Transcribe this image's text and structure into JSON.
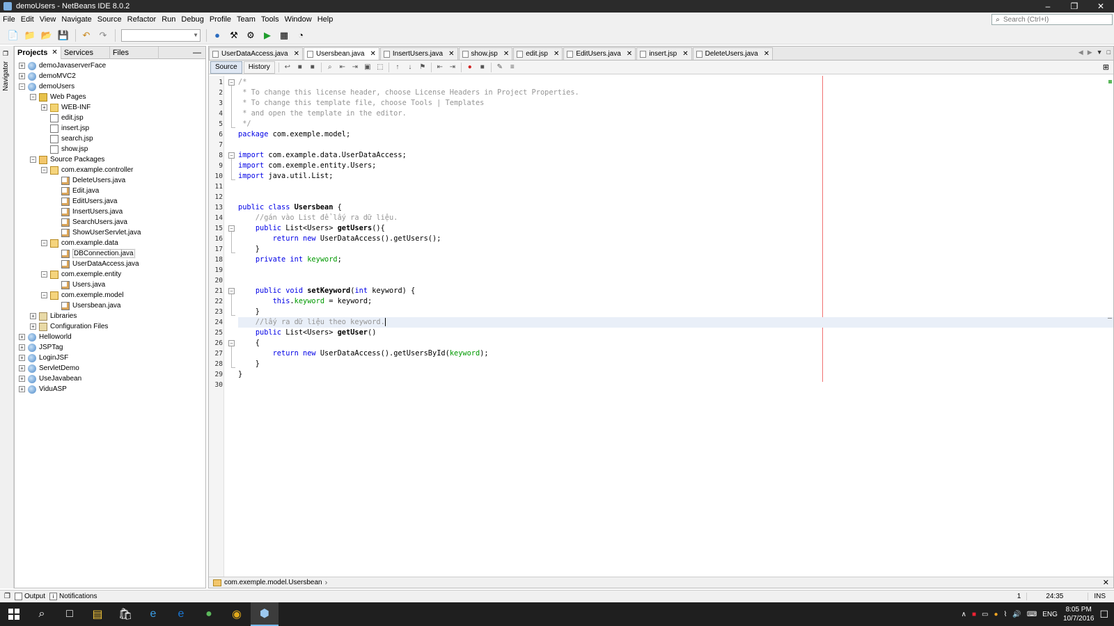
{
  "window": {
    "title": "demoUsers - NetBeans IDE 8.0.2",
    "controls": [
      "–",
      "❐",
      "✕"
    ]
  },
  "menu": {
    "items": [
      "File",
      "Edit",
      "View",
      "Navigate",
      "Source",
      "Refactor",
      "Run",
      "Debug",
      "Profile",
      "Team",
      "Tools",
      "Window",
      "Help"
    ],
    "search_placeholder": "Search (Ctrl+I)"
  },
  "side_strip": {
    "label": "Navigator"
  },
  "projects_panel": {
    "tabs": [
      "Projects",
      "Services",
      "Files"
    ],
    "active_tab": "Projects",
    "tree": [
      {
        "label": "demoJavaserverFace",
        "depth": 0,
        "toggle": "+",
        "icon": "project"
      },
      {
        "label": "demoMVC2",
        "depth": 0,
        "toggle": "+",
        "icon": "project"
      },
      {
        "label": "demoUsers",
        "depth": 0,
        "toggle": "−",
        "icon": "project"
      },
      {
        "label": "Web Pages",
        "depth": 1,
        "toggle": "−",
        "icon": "webpages"
      },
      {
        "label": "WEB-INF",
        "depth": 2,
        "toggle": "+",
        "icon": "folder"
      },
      {
        "label": "edit.jsp",
        "depth": 2,
        "toggle": "",
        "icon": "file"
      },
      {
        "label": "insert.jsp",
        "depth": 2,
        "toggle": "",
        "icon": "file"
      },
      {
        "label": "search.jsp",
        "depth": 2,
        "toggle": "",
        "icon": "file"
      },
      {
        "label": "show.jsp",
        "depth": 2,
        "toggle": "",
        "icon": "file"
      },
      {
        "label": "Source Packages",
        "depth": 1,
        "toggle": "−",
        "icon": "srcpkg"
      },
      {
        "label": "com.example.controller",
        "depth": 2,
        "toggle": "−",
        "icon": "package"
      },
      {
        "label": "DeleteUsers.java",
        "depth": 3,
        "toggle": "",
        "icon": "java"
      },
      {
        "label": "Edit.java",
        "depth": 3,
        "toggle": "",
        "icon": "java"
      },
      {
        "label": "EditUsers.java",
        "depth": 3,
        "toggle": "",
        "icon": "java"
      },
      {
        "label": "InsertUsers.java",
        "depth": 3,
        "toggle": "",
        "icon": "java"
      },
      {
        "label": "SearchUsers.java",
        "depth": 3,
        "toggle": "",
        "icon": "java"
      },
      {
        "label": "ShowUserServlet.java",
        "depth": 3,
        "toggle": "",
        "icon": "java"
      },
      {
        "label": "com.example.data",
        "depth": 2,
        "toggle": "−",
        "icon": "package"
      },
      {
        "label": "DBConnection.java",
        "depth": 3,
        "toggle": "",
        "icon": "java",
        "selected": true
      },
      {
        "label": "UserDataAccess.java",
        "depth": 3,
        "toggle": "",
        "icon": "java"
      },
      {
        "label": "com.exemple.entity",
        "depth": 2,
        "toggle": "−",
        "icon": "package"
      },
      {
        "label": "Users.java",
        "depth": 3,
        "toggle": "",
        "icon": "java"
      },
      {
        "label": "com.exemple.model",
        "depth": 2,
        "toggle": "−",
        "icon": "package"
      },
      {
        "label": "Usersbean.java",
        "depth": 3,
        "toggle": "",
        "icon": "java"
      },
      {
        "label": "Libraries",
        "depth": 1,
        "toggle": "+",
        "icon": "lib"
      },
      {
        "label": "Configuration Files",
        "depth": 1,
        "toggle": "+",
        "icon": "config"
      },
      {
        "label": "Helloworld",
        "depth": 0,
        "toggle": "+",
        "icon": "project"
      },
      {
        "label": "JSPTag",
        "depth": 0,
        "toggle": "+",
        "icon": "project"
      },
      {
        "label": "LoginJSF",
        "depth": 0,
        "toggle": "+",
        "icon": "project"
      },
      {
        "label": "ServletDemo",
        "depth": 0,
        "toggle": "+",
        "icon": "project"
      },
      {
        "label": "UseJavabean",
        "depth": 0,
        "toggle": "+",
        "icon": "project"
      },
      {
        "label": "ViduASP",
        "depth": 0,
        "toggle": "+",
        "icon": "project"
      }
    ]
  },
  "editor": {
    "tabs": [
      {
        "label": "UserDataAccess.java",
        "active": false
      },
      {
        "label": "Usersbean.java",
        "active": true
      },
      {
        "label": "InsertUsers.java",
        "active": false
      },
      {
        "label": "show.jsp",
        "active": false
      },
      {
        "label": "edit.jsp",
        "active": false
      },
      {
        "label": "EditUsers.java",
        "active": false
      },
      {
        "label": "insert.jsp",
        "active": false
      },
      {
        "label": "DeleteUsers.java",
        "active": false
      }
    ],
    "view_tabs": {
      "source": "Source",
      "history": "History"
    },
    "lines": [
      {
        "n": 1,
        "fold": "−",
        "parts": [
          {
            "t": "/*",
            "c": "cm"
          }
        ]
      },
      {
        "n": 2,
        "parts": [
          {
            "t": " * To change this license header, choose License Headers in Project Properties.",
            "c": "cm"
          }
        ]
      },
      {
        "n": 3,
        "parts": [
          {
            "t": " * To change this template file, choose Tools | Templates",
            "c": "cm"
          }
        ]
      },
      {
        "n": 4,
        "parts": [
          {
            "t": " * and open the template in the editor.",
            "c": "cm"
          }
        ]
      },
      {
        "n": 5,
        "parts": [
          {
            "t": " */",
            "c": "cm"
          }
        ]
      },
      {
        "n": 6,
        "parts": [
          {
            "t": "package",
            "c": "kw"
          },
          {
            "t": " com.exemple.model;",
            "c": ""
          }
        ]
      },
      {
        "n": 7,
        "parts": []
      },
      {
        "n": 8,
        "fold": "−",
        "parts": [
          {
            "t": "import",
            "c": "kw"
          },
          {
            "t": " com.example.data.UserDataAccess;",
            "c": ""
          }
        ]
      },
      {
        "n": 9,
        "parts": [
          {
            "t": "import",
            "c": "kw"
          },
          {
            "t": " com.exemple.entity.Users;",
            "c": ""
          }
        ]
      },
      {
        "n": 10,
        "parts": [
          {
            "t": "import",
            "c": "kw"
          },
          {
            "t": " java.util.List;",
            "c": ""
          }
        ]
      },
      {
        "n": 11,
        "parts": []
      },
      {
        "n": 12,
        "parts": []
      },
      {
        "n": 13,
        "parts": [
          {
            "t": "public",
            "c": "kw"
          },
          {
            "t": " ",
            "c": ""
          },
          {
            "t": "class",
            "c": "kw"
          },
          {
            "t": " ",
            "c": ""
          },
          {
            "t": "Usersbean",
            "c": "cls"
          },
          {
            "t": " {",
            "c": ""
          }
        ]
      },
      {
        "n": 14,
        "parts": [
          {
            "t": "    //gán vào List để lấy ra dữ liệu.",
            "c": "cm"
          }
        ]
      },
      {
        "n": 15,
        "fold": "−",
        "parts": [
          {
            "t": "    ",
            "c": ""
          },
          {
            "t": "public",
            "c": "kw"
          },
          {
            "t": " List<Users> ",
            "c": ""
          },
          {
            "t": "getUsers",
            "c": "cls"
          },
          {
            "t": "(){",
            "c": ""
          }
        ]
      },
      {
        "n": 16,
        "parts": [
          {
            "t": "        ",
            "c": ""
          },
          {
            "t": "return",
            "c": "kw"
          },
          {
            "t": " ",
            "c": ""
          },
          {
            "t": "new",
            "c": "kw"
          },
          {
            "t": " UserDataAccess().getUsers();",
            "c": ""
          }
        ]
      },
      {
        "n": 17,
        "parts": [
          {
            "t": "    }",
            "c": ""
          }
        ]
      },
      {
        "n": 18,
        "parts": [
          {
            "t": "    ",
            "c": ""
          },
          {
            "t": "private",
            "c": "kw"
          },
          {
            "t": " ",
            "c": ""
          },
          {
            "t": "int",
            "c": "kw"
          },
          {
            "t": " ",
            "c": ""
          },
          {
            "t": "keyword",
            "c": "fld"
          },
          {
            "t": ";",
            "c": ""
          }
        ]
      },
      {
        "n": 19,
        "parts": []
      },
      {
        "n": 20,
        "parts": []
      },
      {
        "n": 21,
        "fold": "−",
        "parts": [
          {
            "t": "    ",
            "c": ""
          },
          {
            "t": "public",
            "c": "kw"
          },
          {
            "t": " ",
            "c": ""
          },
          {
            "t": "void",
            "c": "kw"
          },
          {
            "t": " ",
            "c": ""
          },
          {
            "t": "setKeyword",
            "c": "cls"
          },
          {
            "t": "(",
            "c": ""
          },
          {
            "t": "int",
            "c": "kw"
          },
          {
            "t": " keyword) {",
            "c": ""
          }
        ]
      },
      {
        "n": 22,
        "parts": [
          {
            "t": "        ",
            "c": ""
          },
          {
            "t": "this",
            "c": "kw"
          },
          {
            "t": ".",
            "c": ""
          },
          {
            "t": "keyword",
            "c": "fld"
          },
          {
            "t": " = keyword;",
            "c": ""
          }
        ]
      },
      {
        "n": 23,
        "parts": [
          {
            "t": "    }",
            "c": ""
          }
        ]
      },
      {
        "n": 24,
        "current": true,
        "parts": [
          {
            "t": "    //lấy ra dữ liệu theo keyword.",
            "c": "cm"
          }
        ]
      },
      {
        "n": 25,
        "parts": [
          {
            "t": "    ",
            "c": ""
          },
          {
            "t": "public",
            "c": "kw"
          },
          {
            "t": " List<Users> ",
            "c": ""
          },
          {
            "t": "getUser",
            "c": "cls"
          },
          {
            "t": "()",
            "c": ""
          }
        ]
      },
      {
        "n": 26,
        "fold": "−",
        "parts": [
          {
            "t": "    {",
            "c": ""
          }
        ]
      },
      {
        "n": 27,
        "parts": [
          {
            "t": "        ",
            "c": ""
          },
          {
            "t": "return",
            "c": "kw"
          },
          {
            "t": " ",
            "c": ""
          },
          {
            "t": "new",
            "c": "kw"
          },
          {
            "t": " UserDataAccess().getUsersById(",
            "c": ""
          },
          {
            "t": "keyword",
            "c": "fld"
          },
          {
            "t": ");",
            "c": ""
          }
        ]
      },
      {
        "n": 28,
        "parts": [
          {
            "t": "    }",
            "c": ""
          }
        ]
      },
      {
        "n": 29,
        "parts": [
          {
            "t": "}",
            "c": ""
          }
        ]
      },
      {
        "n": 30,
        "parts": []
      }
    ],
    "breadcrumb": "com.exemple.model.Usersbean"
  },
  "statusbar": {
    "output": "Output",
    "notifications": "Notifications",
    "position": "24:35",
    "mode": "INS"
  },
  "taskbar": {
    "lang": "ENG",
    "time": "8:05 PM",
    "date": "10/7/2016"
  },
  "colors": {
    "keyword": "#0000e6",
    "comment": "#969696",
    "field": "#009900",
    "margin": "#f07070",
    "titlebar": "#2b2b2b",
    "taskbar": "#1f1f1f"
  }
}
